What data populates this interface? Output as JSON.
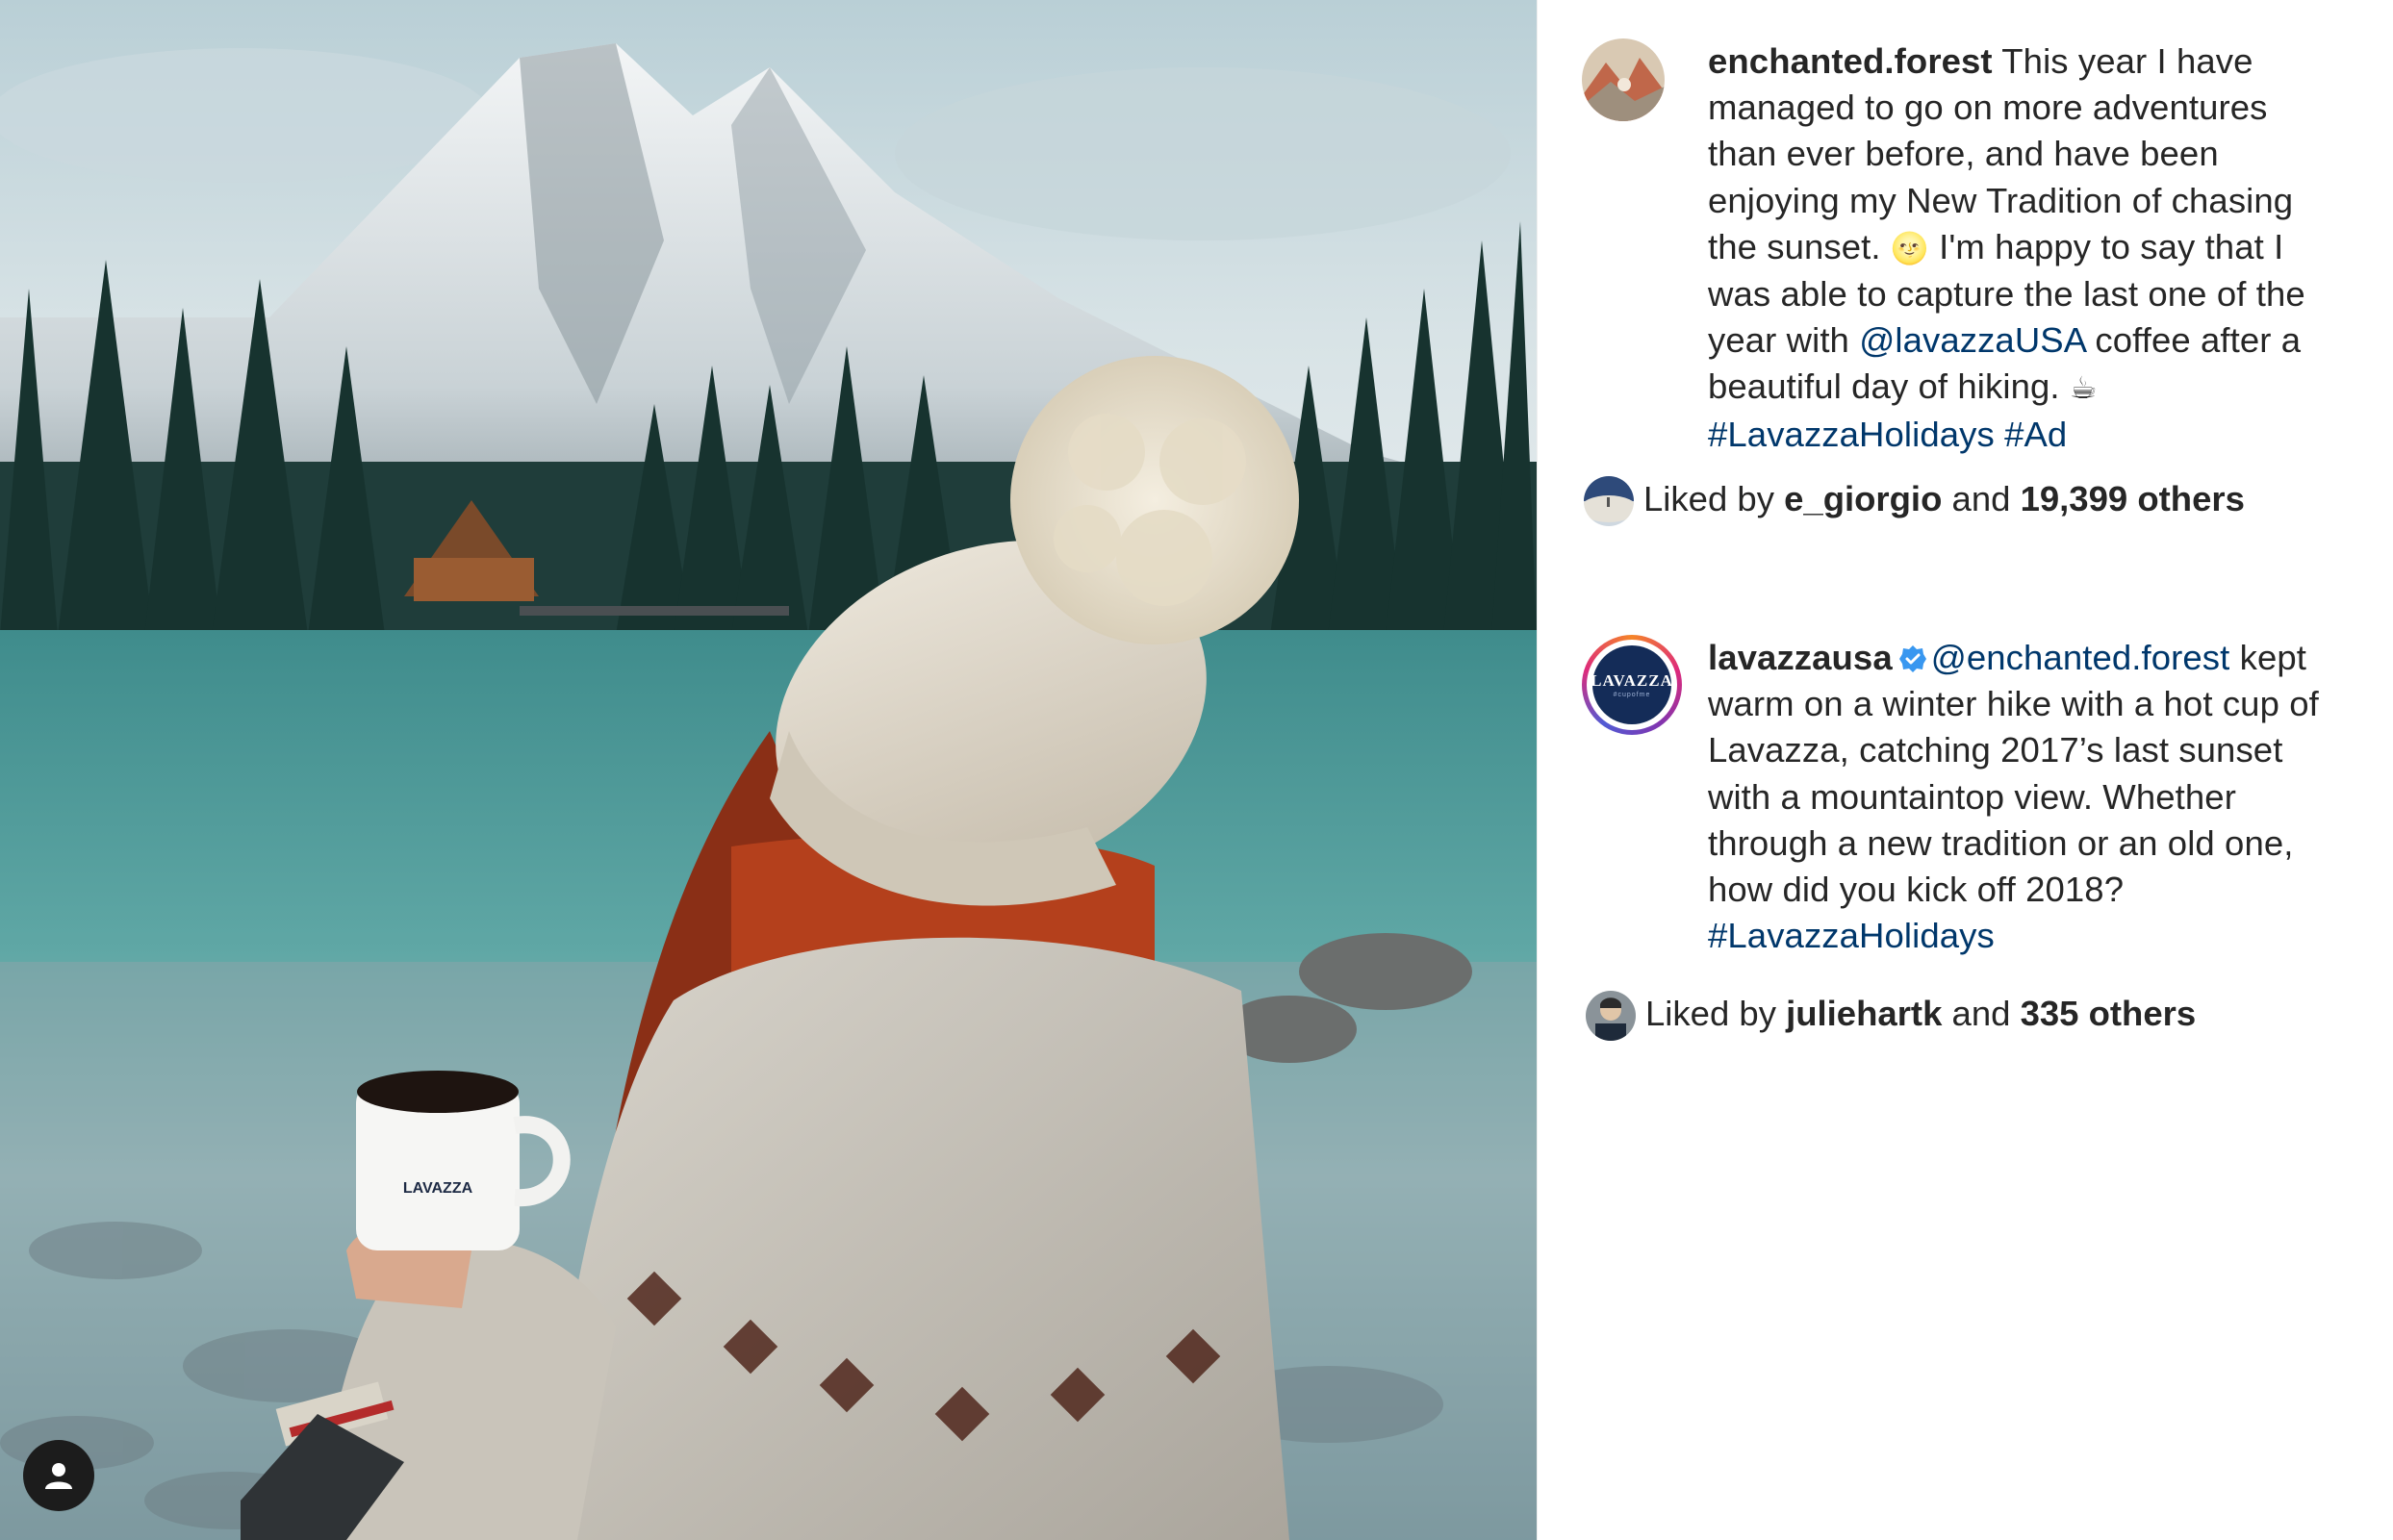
{
  "post_1": {
    "username": "enchanted.forest",
    "caption_lines": [
      " This year I have",
      "managed to go on more adventures",
      "than ever before, and have been",
      "enjoying my New Tradition of chasing",
      "the sunset. ",
      " I'm happy to say that I",
      "was able to capture the last one of the",
      "year with ",
      "@lavazzaUSA",
      " coffee after a",
      "beautiful day of hiking. ",
      "#LavazzaHolidays",
      "#Ad"
    ],
    "emoji_1": "🌝",
    "emoji_2": "☕",
    "likes": {
      "prefix": "Liked by ",
      "user": "e_giorgio",
      "middle": " and ",
      "count": "19,399 others"
    }
  },
  "post_2": {
    "username": "lavazzausa",
    "verified_icon": "verified-badge-icon",
    "avatar_logo_text": "LAVAZZA",
    "avatar_logo_sub": "#cupofme",
    "mention": "@enchanted.forest",
    "caption_lines": [
      " kept",
      "warm on a winter hike with a hot cup of",
      "Lavazza, catching 2017’s last sunset",
      "with a mountaintop view. Whether",
      "through a new tradition or an old one,",
      "how did you kick off 2018?",
      "#LavazzaHolidays"
    ],
    "likes": {
      "prefix": "Liked by ",
      "user": "juliehartk",
      "middle": " and ",
      "count": "335 others"
    }
  },
  "photo": {
    "mug_brand": "LAVAZZA",
    "tag_icon": "user-tag-icon"
  },
  "colors": {
    "link": "#00376b",
    "text": "#262626",
    "verified": "#3897f0"
  }
}
